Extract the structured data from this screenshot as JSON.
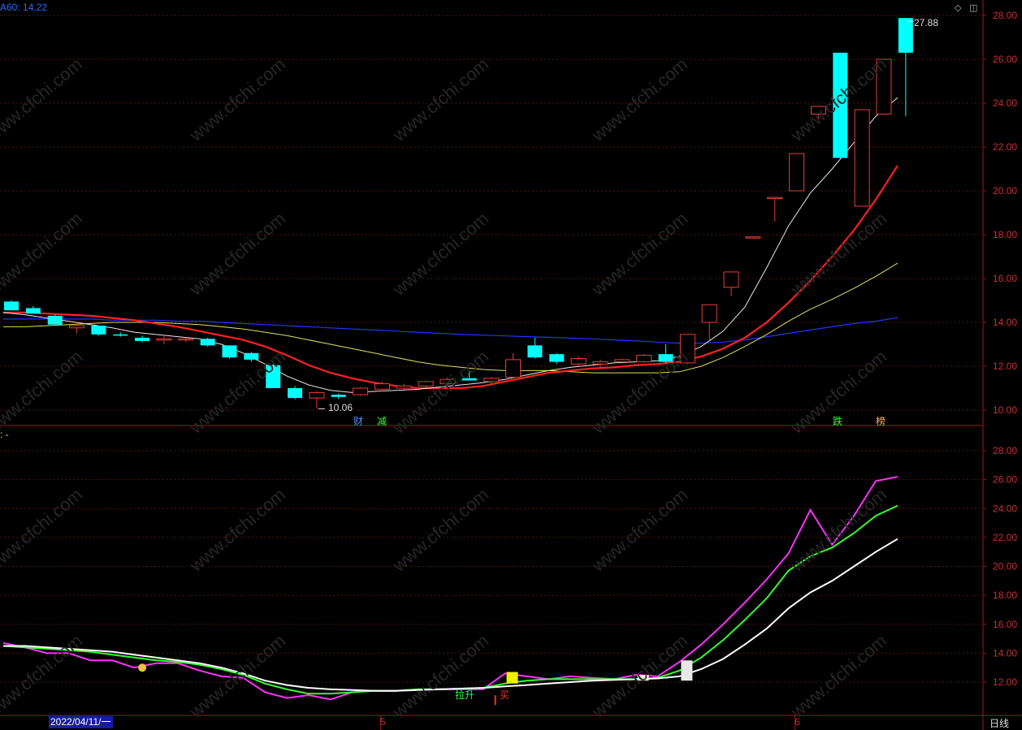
{
  "header": {
    "ma_label": "A60: 14.22",
    "sub_label": ": -"
  },
  "footer": {
    "date": "2022/04/11/一",
    "month_5": "5",
    "month_6": "6",
    "period": "日线"
  },
  "markers": {
    "cai": "财",
    "jian": "减",
    "die": "跌",
    "bang": "榜",
    "lashen": "拉升",
    "buy": "买"
  },
  "annotations": {
    "high": "27.88",
    "low": "10.06"
  },
  "watermark": "www.cfchi.com",
  "colors": {
    "up": "#e83c3c",
    "down": "#00ffff",
    "ma_white": "#e8e8e8",
    "ma_red": "#ff2020",
    "ma_yellow": "#e0e060",
    "ma_blue": "#2233ff",
    "grid": "#5a1010",
    "magenta": "#ff30ff",
    "green": "#30ff30"
  },
  "chart_data": {
    "type": "candlestick",
    "price_axis": {
      "ylim": [
        9.6,
        28.6
      ],
      "ticks": [
        "28.00",
        "26.00",
        "24.00",
        "22.00",
        "20.00",
        "18.00",
        "16.00",
        "14.00",
        "12.00",
        "10.00"
      ]
    },
    "indicator_axis": {
      "ylim": [
        10.4,
        29.4
      ],
      "ticks": [
        "28.00",
        "26.00",
        "24.00",
        "22.00",
        "20.00",
        "18.00",
        "16.00",
        "14.00",
        "12.00"
      ]
    },
    "candles": [
      {
        "o": 14.95,
        "h": 15.0,
        "l": 14.55,
        "c": 14.55
      },
      {
        "o": 14.65,
        "h": 14.75,
        "l": 14.4,
        "c": 14.4
      },
      {
        "o": 14.3,
        "h": 14.35,
        "l": 13.9,
        "c": 13.9
      },
      {
        "o": 13.75,
        "h": 13.95,
        "l": 13.5,
        "c": 13.85
      },
      {
        "o": 13.85,
        "h": 13.85,
        "l": 13.4,
        "c": 13.45
      },
      {
        "o": 13.45,
        "h": 13.55,
        "l": 13.35,
        "c": 13.4
      },
      {
        "o": 13.3,
        "h": 13.4,
        "l": 13.1,
        "c": 13.15
      },
      {
        "o": 13.25,
        "h": 13.45,
        "l": 13.0,
        "c": 13.25
      },
      {
        "o": 13.25,
        "h": 13.3,
        "l": 13.1,
        "c": 13.25
      },
      {
        "o": 13.25,
        "h": 13.3,
        "l": 12.9,
        "c": 12.95
      },
      {
        "o": 12.95,
        "h": 12.95,
        "l": 12.35,
        "c": 12.4
      },
      {
        "o": 12.6,
        "h": 12.65,
        "l": 12.2,
        "c": 12.3
      },
      {
        "o": 12.05,
        "h": 12.1,
        "l": 11.0,
        "c": 11.0
      },
      {
        "o": 11.0,
        "h": 11.1,
        "l": 10.5,
        "c": 10.55
      },
      {
        "o": 10.55,
        "h": 10.85,
        "l": 10.06,
        "c": 10.8
      },
      {
        "o": 10.7,
        "h": 10.75,
        "l": 10.5,
        "c": 10.6
      },
      {
        "o": 10.7,
        "h": 11.05,
        "l": 10.65,
        "c": 11.0
      },
      {
        "o": 10.95,
        "h": 11.3,
        "l": 10.85,
        "c": 11.2
      },
      {
        "o": 11.0,
        "h": 11.2,
        "l": 10.95,
        "c": 11.1
      },
      {
        "o": 11.1,
        "h": 11.35,
        "l": 11.0,
        "c": 11.3
      },
      {
        "o": 11.2,
        "h": 11.5,
        "l": 11.1,
        "c": 11.4
      },
      {
        "o": 11.45,
        "h": 11.85,
        "l": 11.35,
        "c": 11.35
      },
      {
        "o": 11.3,
        "h": 11.5,
        "l": 11.2,
        "c": 11.45
      },
      {
        "o": 11.5,
        "h": 12.6,
        "l": 11.45,
        "c": 12.3
      },
      {
        "o": 12.95,
        "h": 13.3,
        "l": 12.35,
        "c": 12.4
      },
      {
        "o": 12.55,
        "h": 12.6,
        "l": 12.1,
        "c": 12.2
      },
      {
        "o": 12.1,
        "h": 12.45,
        "l": 12.0,
        "c": 12.35
      },
      {
        "o": 12.1,
        "h": 12.3,
        "l": 11.9,
        "c": 12.2
      },
      {
        "o": 12.2,
        "h": 12.35,
        "l": 12.1,
        "c": 12.3
      },
      {
        "o": 12.2,
        "h": 12.55,
        "l": 12.15,
        "c": 12.5
      },
      {
        "o": 12.55,
        "h": 13.0,
        "l": 12.15,
        "c": 12.2
      },
      {
        "o": 12.15,
        "h": 13.45,
        "l": 12.1,
        "c": 13.45
      },
      {
        "o": 14.0,
        "h": 14.8,
        "l": 13.2,
        "c": 14.8
      },
      {
        "o": 15.6,
        "h": 16.3,
        "l": 15.2,
        "c": 16.3
      },
      {
        "o": 17.9,
        "h": 17.9,
        "l": 17.9,
        "c": 17.9
      },
      {
        "o": 19.7,
        "h": 19.7,
        "l": 18.6,
        "c": 19.7
      },
      {
        "o": 20.0,
        "h": 21.7,
        "l": 20.0,
        "c": 21.7
      },
      {
        "o": 23.5,
        "h": 23.85,
        "l": 23.2,
        "c": 23.85
      },
      {
        "o": 26.3,
        "h": 26.3,
        "l": 21.5,
        "c": 21.5
      },
      {
        "o": 19.3,
        "h": 23.7,
        "l": 19.3,
        "c": 23.7
      },
      {
        "o": 23.5,
        "h": 26.0,
        "l": 23.5,
        "c": 26.0
      },
      {
        "o": 27.88,
        "h": 27.88,
        "l": 23.4,
        "c": 26.3
      }
    ],
    "ma_lines": {
      "white": [
        14.45,
        14.35,
        14.2,
        14.05,
        13.9,
        13.75,
        13.55,
        13.45,
        13.35,
        13.25,
        13.0,
        12.6,
        12.1,
        11.55,
        11.15,
        10.9,
        10.8,
        10.85,
        10.9,
        10.95,
        11.05,
        11.15,
        11.25,
        11.4,
        11.6,
        11.8,
        11.95,
        12.05,
        12.15,
        12.2,
        12.25,
        12.45,
        12.9,
        13.6,
        14.7,
        16.5,
        18.4,
        19.9,
        21.0,
        22.2,
        23.4,
        24.25
      ],
      "red": [
        14.45,
        14.45,
        14.4,
        14.35,
        14.3,
        14.2,
        14.1,
        13.95,
        13.8,
        13.6,
        13.4,
        13.2,
        12.9,
        12.5,
        12.05,
        11.7,
        11.45,
        11.25,
        11.1,
        11.0,
        11.0,
        11.0,
        11.1,
        11.3,
        11.5,
        11.7,
        11.8,
        11.9,
        11.95,
        12.05,
        12.1,
        12.2,
        12.45,
        12.8,
        13.3,
        14.0,
        14.9,
        15.9,
        17.0,
        18.2,
        19.6,
        21.15
      ],
      "yellow": [
        13.8,
        13.8,
        13.85,
        13.9,
        13.95,
        14.0,
        14.0,
        14.0,
        13.95,
        13.9,
        13.8,
        13.7,
        13.55,
        13.4,
        13.2,
        13.0,
        12.8,
        12.6,
        12.4,
        12.2,
        12.05,
        11.95,
        11.85,
        11.8,
        11.8,
        11.8,
        11.75,
        11.7,
        11.7,
        11.7,
        11.7,
        11.75,
        12.0,
        12.4,
        12.9,
        13.45,
        14.05,
        14.6,
        15.05,
        15.55,
        16.1,
        16.7
      ],
      "blue": [
        14.15,
        14.15,
        14.15,
        14.15,
        14.15,
        14.1,
        14.1,
        14.1,
        14.05,
        14.05,
        14.0,
        13.95,
        13.9,
        13.85,
        13.8,
        13.75,
        13.7,
        13.65,
        13.6,
        13.55,
        13.5,
        13.45,
        13.42,
        13.38,
        13.35,
        13.32,
        13.28,
        13.25,
        13.2,
        13.15,
        13.1,
        13.05,
        13.05,
        13.1,
        13.2,
        13.35,
        13.5,
        13.65,
        13.8,
        13.95,
        14.05,
        14.22
      ]
    },
    "indicator_lines": {
      "magenta": [
        14.7,
        14.4,
        14.0,
        14.0,
        13.5,
        13.5,
        13.0,
        13.3,
        13.3,
        12.8,
        12.4,
        12.3,
        11.3,
        10.9,
        11.1,
        10.8,
        11.3,
        11.4,
        11.4,
        11.5,
        11.5,
        11.5,
        11.5,
        12.6,
        12.4,
        12.2,
        12.4,
        12.3,
        12.2,
        12.5,
        12.4,
        13.4,
        14.6,
        16.0,
        17.5,
        19.1,
        20.9,
        23.9,
        21.5,
        23.5,
        25.9,
        26.2
      ],
      "green": [
        14.5,
        14.4,
        14.3,
        14.2,
        14.1,
        13.9,
        13.7,
        13.5,
        13.4,
        13.2,
        12.9,
        12.5,
        11.9,
        11.5,
        11.2,
        11.2,
        11.3,
        11.4,
        11.4,
        11.5,
        11.5,
        11.55,
        11.6,
        11.9,
        12.1,
        12.2,
        12.2,
        12.2,
        12.2,
        12.2,
        12.3,
        12.8,
        13.7,
        14.9,
        16.3,
        17.8,
        19.7,
        20.7,
        21.3,
        22.3,
        23.5,
        24.2
      ],
      "white": [
        14.5,
        14.5,
        14.4,
        14.3,
        14.2,
        14.1,
        13.9,
        13.7,
        13.5,
        13.3,
        13.0,
        12.6,
        12.1,
        11.8,
        11.6,
        11.5,
        11.45,
        11.4,
        11.4,
        11.45,
        11.5,
        11.55,
        11.6,
        11.7,
        11.8,
        11.9,
        12.0,
        12.1,
        12.15,
        12.2,
        12.25,
        12.4,
        12.9,
        13.6,
        14.6,
        15.7,
        17.1,
        18.2,
        19.0,
        20.0,
        21.0,
        21.9
      ]
    }
  }
}
